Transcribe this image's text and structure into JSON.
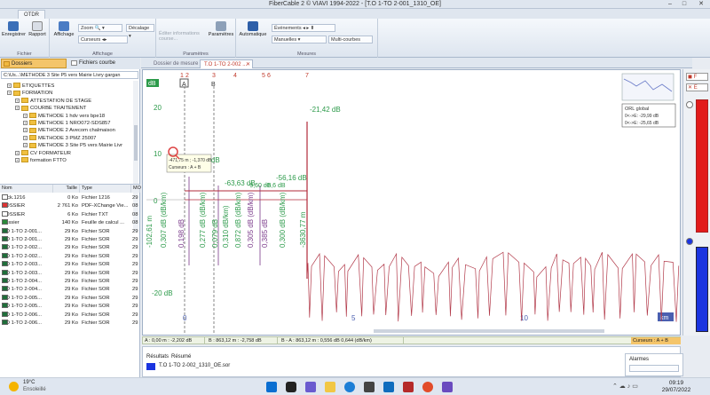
{
  "window": {
    "title": "FiberCable 2 © VIAVI 1994-2022 - [T.O 1-TO 2-001_1310_OE]",
    "min": "–",
    "max": "□",
    "close": "✕"
  },
  "ribbon": {
    "menu_tab": "OTDR",
    "fichier": {
      "save": "Enregistrer",
      "report": "Rapport",
      "label": "Fichier"
    },
    "affichage": {
      "display": "Affichage",
      "zoom": "Zoom",
      "offset": "Décalage",
      "cursors": "Curseurs",
      "label": "Affichage"
    },
    "parametres": {
      "info": "Éditer informations",
      "course": "course...",
      "params": "Paramètres",
      "label": "Paramètres"
    },
    "mesures": {
      "auto": "Automatique",
      "events": "Événements",
      "manual": "Manuelles",
      "multi": "Multi-courbes",
      "label": "Mesures"
    }
  },
  "left": {
    "tabs": {
      "folders": "Dossiers",
      "curves": "Fichiers courbe"
    },
    "path": "C:\\Us...\\METHODE 3 Site P5 vers Mairie Livry gargan",
    "tree": [
      {
        "label": "ETIQUETTES",
        "depth": 1
      },
      {
        "label": "FORMATION",
        "depth": 1
      },
      {
        "label": "ATTESTATION DE STAGE",
        "depth": 2
      },
      {
        "label": "COURBE TRAITEMENT",
        "depth": 2
      },
      {
        "label": "METHODE 1 hdv vers bpe18",
        "depth": 3
      },
      {
        "label": "METHODE 1 NRO072-SDS857",
        "depth": 3
      },
      {
        "label": "METHODE 2 Avecom chalmaison",
        "depth": 3
      },
      {
        "label": "METHODE 3 PMZ 25007",
        "depth": 3
      },
      {
        "label": "METHODE 3 Site P5 vers Mairie Livr",
        "depth": 3
      },
      {
        "label": "CV FORMATEUR",
        "depth": 2
      },
      {
        "label": "formation FTTO",
        "depth": 2
      }
    ],
    "columns": {
      "name": "Nom",
      "size": "Taille",
      "type": "Type",
      "mod": "MO"
    },
    "files": [
      {
        "name": ".lock.1216",
        "size": "0 Ko",
        "type": "Fichier 1216",
        "mod": "29"
      },
      {
        "name": "DOSSIER",
        "size": "2 761 Ko",
        "type": "PDF-XChange Vie...",
        "mod": "08"
      },
      {
        "name": "DOSSIER",
        "size": "6 Ko",
        "type": "Fichier TXT",
        "mod": "08"
      },
      {
        "name": "Dossier",
        "size": "140 Ko",
        "type": "Feuille de calcul ...",
        "mod": "08"
      },
      {
        "name": "T.O 1-TO 2-001...",
        "size": "29 Ko",
        "type": "Fichier SOR",
        "mod": "29"
      },
      {
        "name": "T.O 1-TO 2-001...",
        "size": "29 Ko",
        "type": "Fichier SOR",
        "mod": "29"
      },
      {
        "name": "T.O 1-TO 2-002...",
        "size": "29 Ko",
        "type": "Fichier SOR",
        "mod": "29"
      },
      {
        "name": "T.O 1-TO 2-002...",
        "size": "29 Ko",
        "type": "Fichier SOR",
        "mod": "29"
      },
      {
        "name": "T.O 1-TO 2-003...",
        "size": "29 Ko",
        "type": "Fichier SOR",
        "mod": "29"
      },
      {
        "name": "T.O 1-TO 2-003...",
        "size": "29 Ko",
        "type": "Fichier SOR",
        "mod": "29"
      },
      {
        "name": "T.O 1-TO 2-004...",
        "size": "29 Ko",
        "type": "Fichier SOR",
        "mod": "29"
      },
      {
        "name": "T.O 1-TO 2-004...",
        "size": "29 Ko",
        "type": "Fichier SOR",
        "mod": "29"
      },
      {
        "name": "T.O 1-TO 2-005...",
        "size": "29 Ko",
        "type": "Fichier SOR",
        "mod": "29"
      },
      {
        "name": "T.O 1-TO 2-005...",
        "size": "29 Ko",
        "type": "Fichier SOR",
        "mod": "29"
      },
      {
        "name": "T.O 1-TO 2-006...",
        "size": "29 Ko",
        "type": "Fichier SOR",
        "mod": "29"
      },
      {
        "name": "T.O 1-TO 2-006...",
        "size": "29 Ko",
        "type": "Fichier SOR",
        "mod": "29"
      }
    ]
  },
  "doctabs": {
    "folder": "Dossier de mesure",
    "active": "T.O 1-TO 2-002 ...",
    "close": "✕"
  },
  "trace": {
    "y_unit": "dB",
    "x_unit": "km",
    "y_ticks": [
      "20",
      "10",
      "0",
      "-20 dB"
    ],
    "x_ticks": [
      "0",
      "5",
      "10"
    ],
    "marker_labels": [
      "A",
      "B"
    ],
    "event_numbers": [
      "1",
      "2",
      "3",
      "4",
      "5",
      "6",
      "7"
    ],
    "event_values_top": [
      "-21,42 dB",
      "-49,51 dB",
      "-63,63 dB",
      "-56,16 dB",
      "-9,60 dB",
      "-6,6 dB"
    ],
    "vertical_annotations": [
      "-102,61 m",
      "0,307 dB (dB/km)",
      "0,198 dB",
      "0,277 dB (dB/km)",
      "0,079 dB",
      "0,310 dB/km)",
      "0,872 dB (dB/km)",
      "0,305 dB (dB/km)",
      "0,385 dB",
      "0,300 dB (dB/km)",
      "-3630,77 m"
    ],
    "tooltip": {
      "line1": "-471,75 m ; -1,370 dB",
      "line2": "Curseurs : A + B"
    },
    "global_box": {
      "title": "ORL global",
      "line1": "0<->E: -29,99 dB",
      "line2": "0<->E: -25,65 dB"
    }
  },
  "statusline": {
    "a": "A : 0,00 m : -2,202 dB",
    "b": "B : 863,12 m : -2,758 dB",
    "ba": "B - A : 863,12 m : 0,556 dB 0,644 (dB/km)",
    "cursors": "Curseurs : A + B"
  },
  "results": {
    "tabs": {
      "results": "Résultats",
      "summary": "Résumé"
    },
    "row": "T.O 1-TO 2-002_1310_OE.sor",
    "alarms": "Alarmes"
  },
  "taskbar": {
    "temp": "19°C",
    "weather": "Ensoleillé",
    "time": "09:19",
    "date": "29/07/2022"
  }
}
